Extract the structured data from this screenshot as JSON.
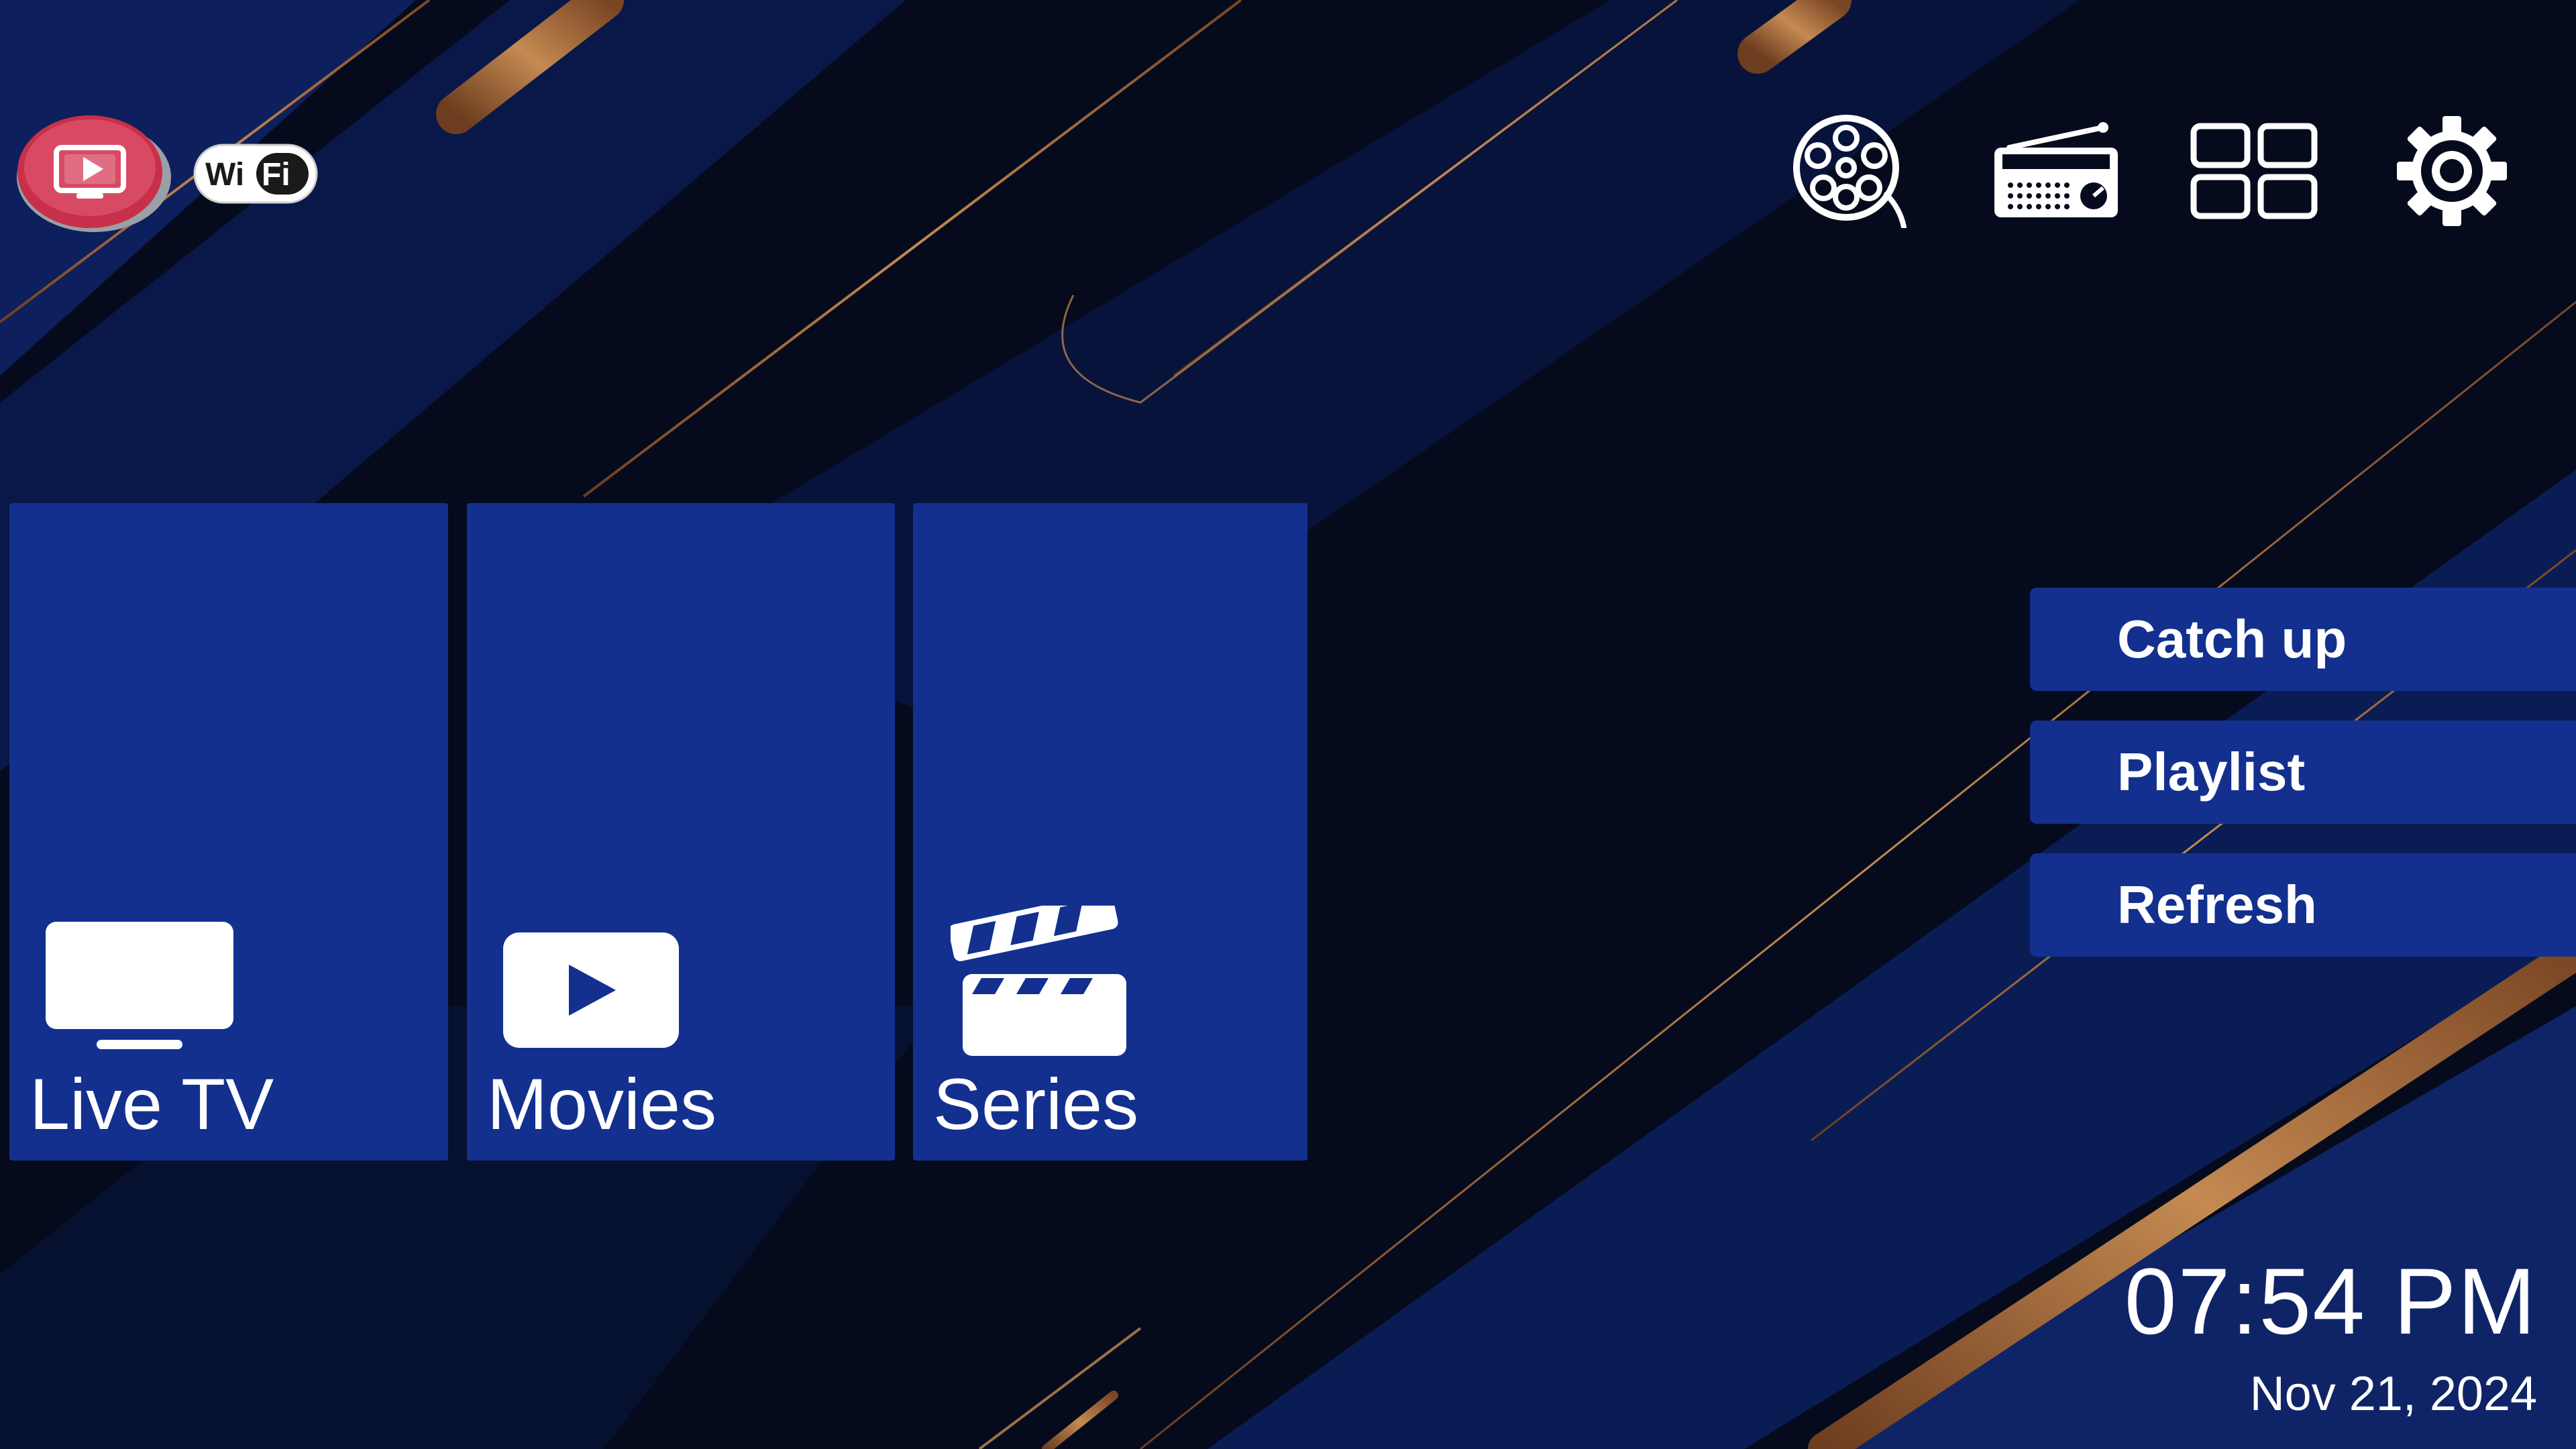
{
  "theme": {
    "background": "#050b1c",
    "tile_color": "#13308f",
    "accent_stripe": "#b87a45",
    "logo_color": "#c8304a"
  },
  "header": {
    "logo_icon": "tv-play-logo-icon",
    "wifi_badge": {
      "icon": "wifi-icon",
      "text_left": "Wi",
      "text_right": "Fi"
    },
    "toolbar": [
      {
        "icon": "film-reel-icon"
      },
      {
        "icon": "radio-icon"
      },
      {
        "icon": "grid-icon"
      },
      {
        "icon": "gear-icon"
      }
    ]
  },
  "tiles": [
    {
      "label": "Live TV",
      "icon": "tv-icon"
    },
    {
      "label": "Movies",
      "icon": "play-icon"
    },
    {
      "label": "Series",
      "icon": "clapperboard-icon"
    }
  ],
  "side_menu": [
    {
      "label": "Catch up"
    },
    {
      "label": "Playlist"
    },
    {
      "label": "Refresh"
    }
  ],
  "clock": {
    "time": "07:54 PM",
    "date": "Nov 21, 2024"
  }
}
